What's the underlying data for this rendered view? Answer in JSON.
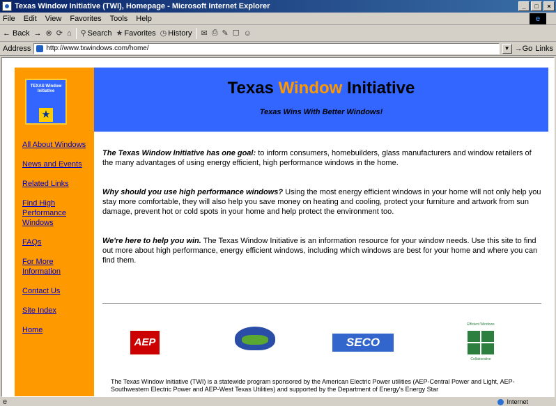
{
  "window": {
    "title": "Texas Window Initiative (TWI), Homepage - Microsoft Internet Explorer",
    "buttons": [
      "_",
      "□",
      "×"
    ]
  },
  "menu": [
    "File",
    "Edit",
    "View",
    "Favorites",
    "Tools",
    "Help"
  ],
  "toolbar": {
    "back": "← Back",
    "forward": "→",
    "search": "Search",
    "favorites": "Favorites",
    "history": "History"
  },
  "address": {
    "label": "Address",
    "url": "http://www.txwindows.com/home/",
    "go": "Go",
    "links": "Links"
  },
  "page": {
    "badge_text": "TEXAS Window Initiative",
    "header_title_1": "Texas ",
    "header_title_accent": "Window",
    "header_title_2": " Initiative",
    "header_subtitle": "Texas Wins With Better Windows!",
    "nav": [
      "All About Windows",
      "News and Events",
      "Related Links",
      "Find High Performance Windows",
      "FAQs",
      "For More Information",
      "Contact Us",
      "Site Index",
      "Home"
    ],
    "p1_bold": "The Texas Window Initiative has one goal:",
    "p1_text": " to inform consumers, homebuilders, glass manufacturers and window retailers of the many advantages of using energy efficient, high performance windows in the home.",
    "p2_bold": "Why should you use high performance windows?",
    "p2_text": " Using the most energy efficient windows in your home will not only help you stay more comfortable, they will also help you save money on heating and cooling, protect your furniture and artwork from sun damage, prevent hot or cold spots in your home and help protect the environment too.",
    "p3_bold": "We're here to help you win.",
    "p3_text": " The Texas Window Initiative is an information resource for your window needs. Use this site to find out more about high performance, energy efficient windows, including which windows are best for your home and where you can find them.",
    "logos": {
      "aep": "AEP",
      "seco": "SECO",
      "window_top": "Efficient Windows",
      "window_bottom": "Collaborative"
    },
    "footer": "The Texas Window Initiative (TWI) is a statewide program sponsored by the American Electric Power utilities (AEP-Central Power and Light, AEP-Southwestern Electric Power and AEP-West Texas Utilities) and supported by the Department of Energy's Energy Star"
  },
  "status": {
    "left": "",
    "zone": "Internet"
  }
}
